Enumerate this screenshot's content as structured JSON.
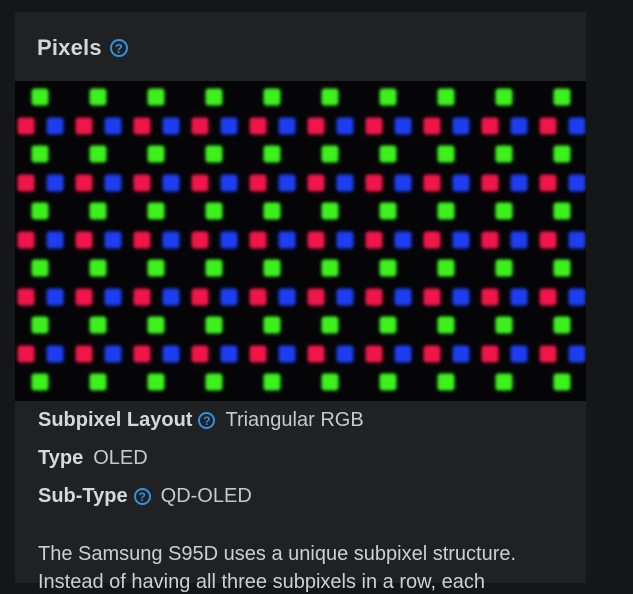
{
  "section": {
    "title": "Pixels",
    "help_icon": "question-circle-icon"
  },
  "image": {
    "description_icon": "subpixel-macro-photo",
    "colors": {
      "green": "#3cf21c",
      "red": "#f0154a",
      "blue": "#1b3df0",
      "background": "#050507"
    }
  },
  "specs": {
    "subpixel_layout": {
      "label": "Subpixel Layout",
      "value": "Triangular RGB"
    },
    "type": {
      "label": "Type",
      "value": "OLED"
    },
    "sub_type": {
      "label": "Sub-Type",
      "value": "QD-OLED"
    }
  },
  "description": {
    "line1": "The Samsung S95D uses a unique subpixel structure.",
    "line2": "Instead of having all three subpixels in a row, each"
  },
  "theme": {
    "accent": "#2f93df",
    "panel_bg": "#202123",
    "page_bg": "#151618"
  }
}
